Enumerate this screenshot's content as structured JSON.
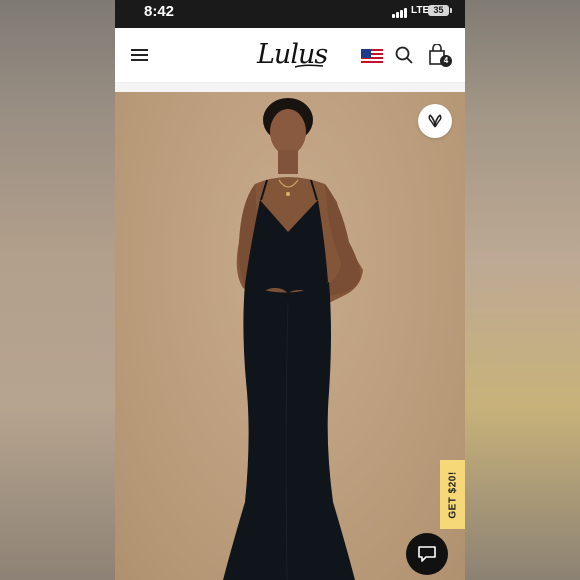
{
  "status_bar": {
    "time": "8:42",
    "network": "LTE",
    "battery_level": "35"
  },
  "header": {
    "logo_text": "Lulus",
    "cart_count": "4",
    "icons": [
      "menu-icon",
      "us-flag-icon",
      "search-icon",
      "shopping-bag-icon"
    ]
  },
  "product": {
    "image_description_icon": "product-photo",
    "favorite_icon": "heart-icon"
  },
  "promo": {
    "label": "GET $20!"
  },
  "chat": {
    "icon": "chat-bubble-icon"
  },
  "colors": {
    "status_bar_bg": "#1a1a1a",
    "photo_bg": "#c0a282",
    "dress": "#0f1319",
    "promo_tab": "#f6d879",
    "chat_button": "#111111"
  }
}
